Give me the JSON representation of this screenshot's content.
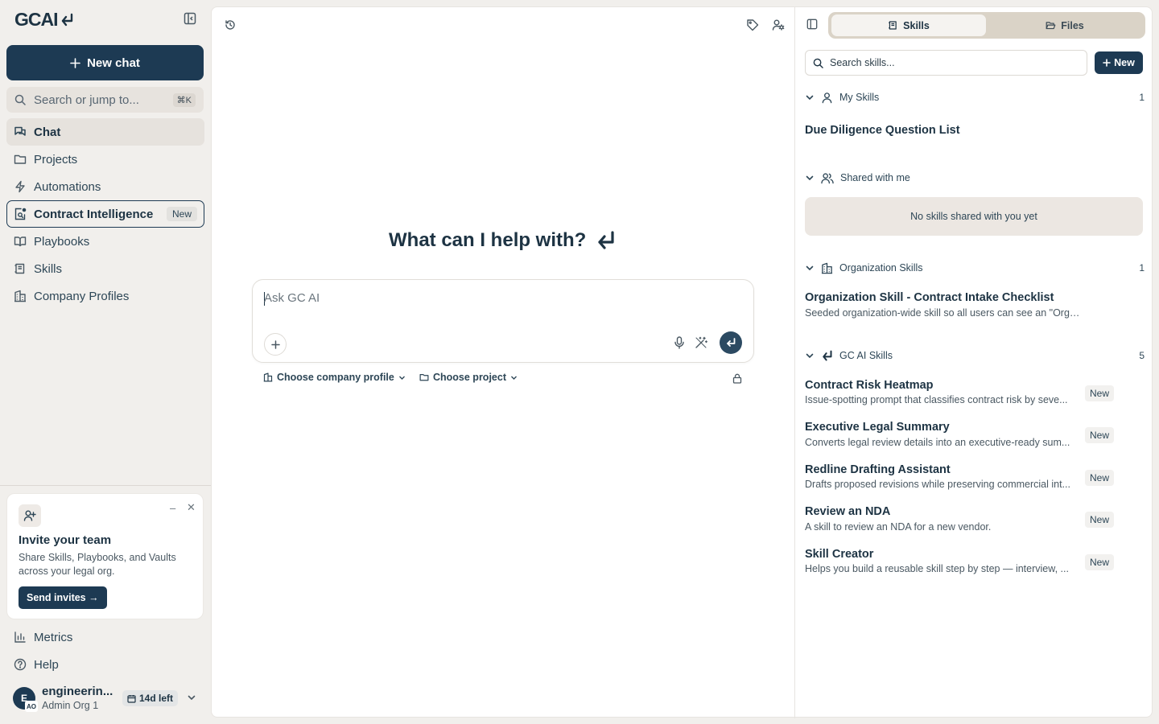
{
  "app": {
    "logo_text": "GCAI"
  },
  "sidebar": {
    "new_chat_label": "New chat",
    "search": {
      "label": "Search or jump to...",
      "shortcut": "⌘K"
    },
    "nav": [
      {
        "label": "Chat",
        "icon": "chat-icon",
        "state": "active"
      },
      {
        "label": "Projects",
        "icon": "folder-icon"
      },
      {
        "label": "Automations",
        "icon": "bolt-icon"
      },
      {
        "label": "Contract Intelligence",
        "icon": "contract-search-icon",
        "badge": "New",
        "state": "outlined"
      },
      {
        "label": "Playbooks",
        "icon": "book-icon"
      },
      {
        "label": "Skills",
        "icon": "skills-icon"
      },
      {
        "label": "Company Profiles",
        "icon": "building-icon"
      }
    ],
    "invite": {
      "title": "Invite your team",
      "description": "Share Skills, Playbooks, and Vaults across your legal org.",
      "button_label": "Send invites →"
    },
    "bottom_nav": [
      {
        "label": "Metrics",
        "icon": "bar-chart-icon"
      },
      {
        "label": "Help",
        "icon": "help-icon"
      }
    ],
    "user": {
      "avatar_initial": "E",
      "avatar_org_initials": "AO",
      "name": "engineerin...",
      "org": "Admin Org 1",
      "trial_label": "14d left"
    }
  },
  "main": {
    "headline": "What can I help with?",
    "composer": {
      "placeholder": "Ask GC AI"
    },
    "company_picker_label": "Choose company profile",
    "project_picker_label": "Choose project"
  },
  "skills_panel": {
    "tabs": [
      {
        "label": "Skills",
        "selected": true
      },
      {
        "label": "Files",
        "selected": false
      }
    ],
    "search_placeholder": "Search skills...",
    "new_button_label": "New",
    "sections": {
      "my_skills": {
        "title": "My Skills",
        "count": "1",
        "items": [
          {
            "title": "Due Diligence Question List"
          }
        ]
      },
      "shared": {
        "title": "Shared with me",
        "empty_text": "No skills shared with you yet"
      },
      "organization": {
        "title": "Organization Skills",
        "count": "1",
        "items": [
          {
            "title": "Organization Skill - Contract Intake Checklist",
            "description": "Seeded organization-wide skill so all users can see an \"Organizat..."
          }
        ]
      },
      "gcai": {
        "title": "GC AI Skills",
        "count": "5",
        "items": [
          {
            "title": "Contract Risk Heatmap",
            "description": "Issue-spotting prompt that classifies contract risk by seve...",
            "badge": "New"
          },
          {
            "title": "Executive Legal Summary",
            "description": "Converts legal review details into an executive-ready sum...",
            "badge": "New"
          },
          {
            "title": "Redline Drafting Assistant",
            "description": "Drafts proposed revisions while preserving commercial int...",
            "badge": "New"
          },
          {
            "title": "Review an NDA",
            "description": "A skill to review an NDA for a new vendor.",
            "badge": "New"
          },
          {
            "title": "Skill Creator",
            "description": "Helps you build a reusable skill step by step — interview, ...",
            "badge": "New"
          }
        ]
      }
    }
  },
  "colors": {
    "brand_navy": "#1d3a53",
    "background": "#f1efec",
    "segmented_bg": "#dad3c7"
  }
}
